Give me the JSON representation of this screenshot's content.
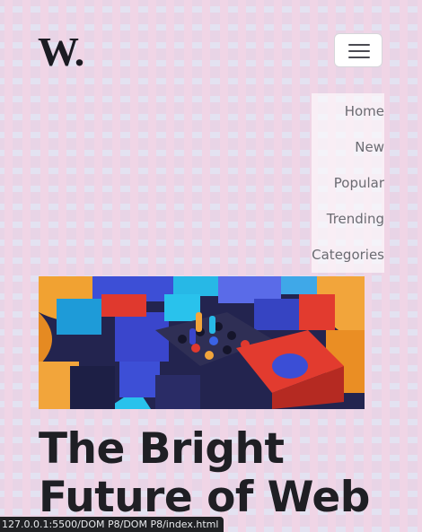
{
  "brand": {
    "logo_text": "W."
  },
  "header": {
    "menu_button_icon": "hamburger-menu-icon"
  },
  "nav": {
    "items": [
      {
        "label": "Home"
      },
      {
        "label": "New"
      },
      {
        "label": "Popular"
      },
      {
        "label": "Trending"
      },
      {
        "label": "Categories"
      }
    ]
  },
  "article": {
    "title": "The Bright Future of Web",
    "hero_image": "colorful-3d-blocks-image"
  },
  "status_bar": {
    "url": "127.0.0.1:5500/DOM P8/DOM P8/index.html"
  },
  "colors": {
    "text_dark": "#1f1f24",
    "nav_text": "#6b6b72",
    "status_bg": "#202124"
  }
}
